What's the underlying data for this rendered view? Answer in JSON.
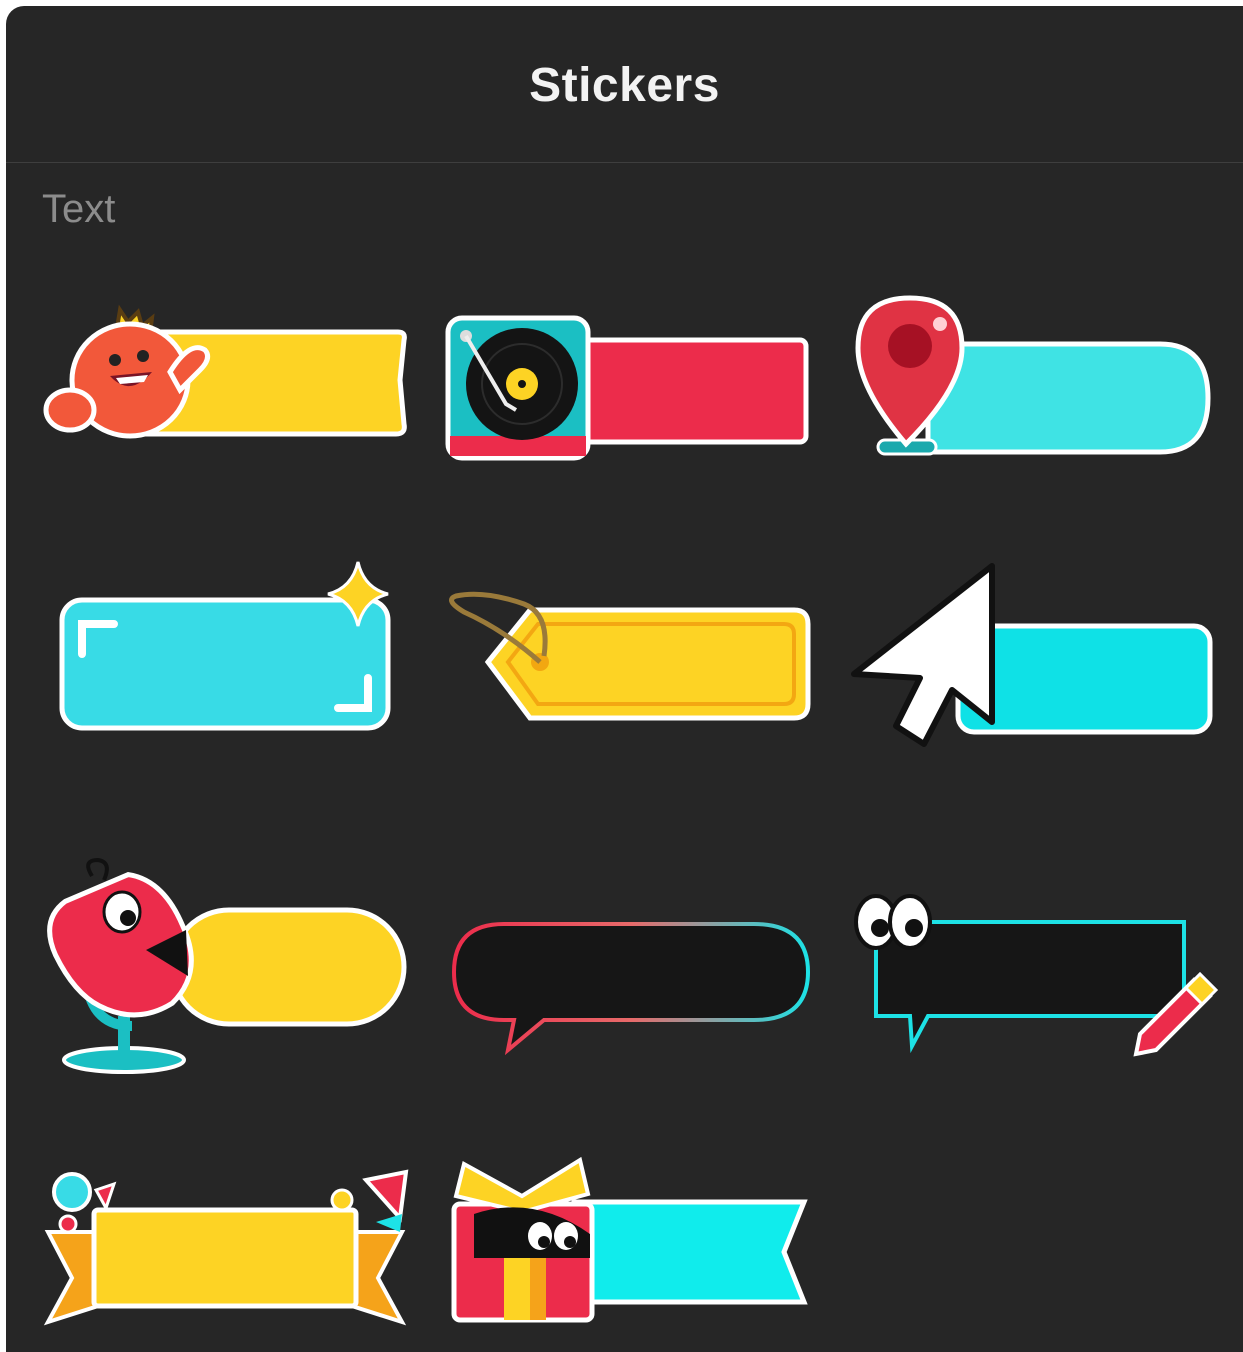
{
  "header": {
    "title": "Stickers"
  },
  "section": {
    "label": "Text"
  },
  "colors": {
    "background": "#262626",
    "yellow": "#fdd324",
    "cyan": "#1de2e6",
    "red": "#ec2c4b",
    "outline": "#ffffff"
  },
  "stickers": [
    {
      "icon": "cute-mascot-icon",
      "fill": "#fdd324"
    },
    {
      "icon": "vinyl-turntable-icon",
      "fill": "#ec2c4b"
    },
    {
      "icon": "map-pin-icon",
      "fill": "#3fe3e4"
    },
    {
      "icon": "sparkle-icon",
      "fill": "#38dbe6"
    },
    {
      "icon": "tag-string-icon",
      "fill": "#fdd324"
    },
    {
      "icon": "cursor-arrow-icon",
      "fill": "#0fe1e6"
    },
    {
      "icon": "microphone-mascot-icon",
      "fill": "#fdd324"
    },
    {
      "icon": "speech-bubble-icon",
      "fill": "#161616"
    },
    {
      "icon": "googly-eyes-pencil-icon",
      "fill": "#161616"
    },
    {
      "icon": "party-balloons-icon",
      "fill": "#fdd324"
    },
    {
      "icon": "gift-box-icon",
      "fill": "#10ecec"
    }
  ]
}
